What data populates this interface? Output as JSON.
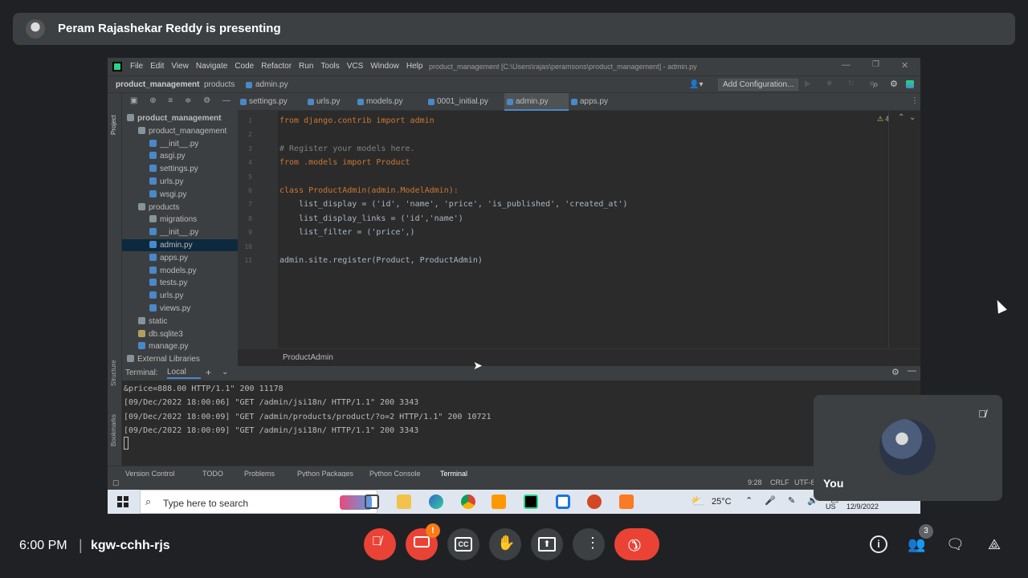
{
  "banner": {
    "presenter_text": "Peram Rajashekar Reddy is presenting"
  },
  "ide": {
    "menu": [
      "File",
      "Edit",
      "View",
      "Navigate",
      "Code",
      "Refactor",
      "Run",
      "Tools",
      "VCS",
      "Window",
      "Help"
    ],
    "window_title": "product_management [C:\\Users\\rajas\\peramsons\\product_management] - admin.py",
    "breadcrumbs": [
      "product_management",
      "products",
      "admin.py"
    ],
    "add_config_label": "Add Configuration...",
    "project_label": "Project",
    "tree": [
      {
        "label": "product_management",
        "depth": 0,
        "type": "folder"
      },
      {
        "label": "product_management",
        "depth": 1,
        "type": "folder"
      },
      {
        "label": "__init__.py",
        "depth": 2,
        "type": "py"
      },
      {
        "label": "asgi.py",
        "depth": 2,
        "type": "py"
      },
      {
        "label": "settings.py",
        "depth": 2,
        "type": "py"
      },
      {
        "label": "urls.py",
        "depth": 2,
        "type": "py"
      },
      {
        "label": "wsgi.py",
        "depth": 2,
        "type": "py"
      },
      {
        "label": "products",
        "depth": 1,
        "type": "folder"
      },
      {
        "label": "migrations",
        "depth": 2,
        "type": "folder"
      },
      {
        "label": "__init__.py",
        "depth": 2,
        "type": "py"
      },
      {
        "label": "admin.py",
        "depth": 2,
        "type": "py",
        "selected": true
      },
      {
        "label": "apps.py",
        "depth": 2,
        "type": "py"
      },
      {
        "label": "models.py",
        "depth": 2,
        "type": "py"
      },
      {
        "label": "tests.py",
        "depth": 2,
        "type": "py"
      },
      {
        "label": "urls.py",
        "depth": 2,
        "type": "py"
      },
      {
        "label": "views.py",
        "depth": 2,
        "type": "py"
      },
      {
        "label": "static",
        "depth": 1,
        "type": "folder"
      },
      {
        "label": "db.sqlite3",
        "depth": 1,
        "type": "db"
      },
      {
        "label": "manage.py",
        "depth": 1,
        "type": "py"
      },
      {
        "label": "External Libraries",
        "depth": 0,
        "type": "lib"
      }
    ],
    "tabs": [
      {
        "label": "settings.py"
      },
      {
        "label": "urls.py"
      },
      {
        "label": "models.py"
      },
      {
        "label": "0001_initial.py"
      },
      {
        "label": "admin.py",
        "active": true
      },
      {
        "label": "apps.py"
      }
    ],
    "warning_count": "4",
    "code": [
      {
        "ln": "1",
        "text": "from django.contrib import admin"
      },
      {
        "ln": "2",
        "text": ""
      },
      {
        "ln": "3",
        "text": "# Register your models here."
      },
      {
        "ln": "4",
        "text": "from .models import Product"
      },
      {
        "ln": "5",
        "text": ""
      },
      {
        "ln": "6",
        "text": "class ProductAdmin(admin.ModelAdmin):"
      },
      {
        "ln": "7",
        "text": "    list_display = ('id', 'name', 'price', 'is_published', 'created_at')"
      },
      {
        "ln": "8",
        "text": "    list_display_links = ('id','name')"
      },
      {
        "ln": "9",
        "text": "    list_filter = ('price',)"
      },
      {
        "ln": "10",
        "text": ""
      },
      {
        "ln": "11",
        "text": "admin.site.register(Product, ProductAdmin)"
      }
    ],
    "editor_breadcrumb": "ProductAdmin",
    "terminal": {
      "label": "Terminal:",
      "tab": "Local",
      "lines": [
        "&price=888.00 HTTP/1.1\" 200 11178",
        "[09/Dec/2022 18:00:06] \"GET /admin/jsi18n/ HTTP/1.1\" 200 3343",
        "[09/Dec/2022 18:00:09] \"GET /admin/products/product/?o=2 HTTP/1.1\" 200 10721",
        "[09/Dec/2022 18:00:09] \"GET /admin/jsi18n/ HTTP/1.1\" 200 3343"
      ]
    },
    "side_labels": {
      "structure": "Structure",
      "bookmarks": "Bookmarks"
    },
    "toolwindows": [
      "Version Control",
      "TODO",
      "Problems",
      "Python Packages",
      "Python Console",
      "Terminal"
    ],
    "status": {
      "position": "9:28",
      "line_sep": "CRLF",
      "encoding": "UTF-8"
    }
  },
  "windows_taskbar": {
    "search_placeholder": "Type here to search",
    "weather": "25°C",
    "lang": "US",
    "date": "12/9/2022"
  },
  "self_tile": {
    "label": "You"
  },
  "meet_bar": {
    "time": "6:00 PM",
    "separator": "|",
    "meeting_code": "kgw-cchh-rjs",
    "participants_count": "3",
    "alert_badge": "!"
  },
  "colors": {
    "meet_bg": "#202124",
    "mic_off_red": "#ea4335",
    "end_call_red": "#ea4335",
    "ide_bg": "#2b2b2b",
    "ide_panel": "#3c3f41"
  }
}
